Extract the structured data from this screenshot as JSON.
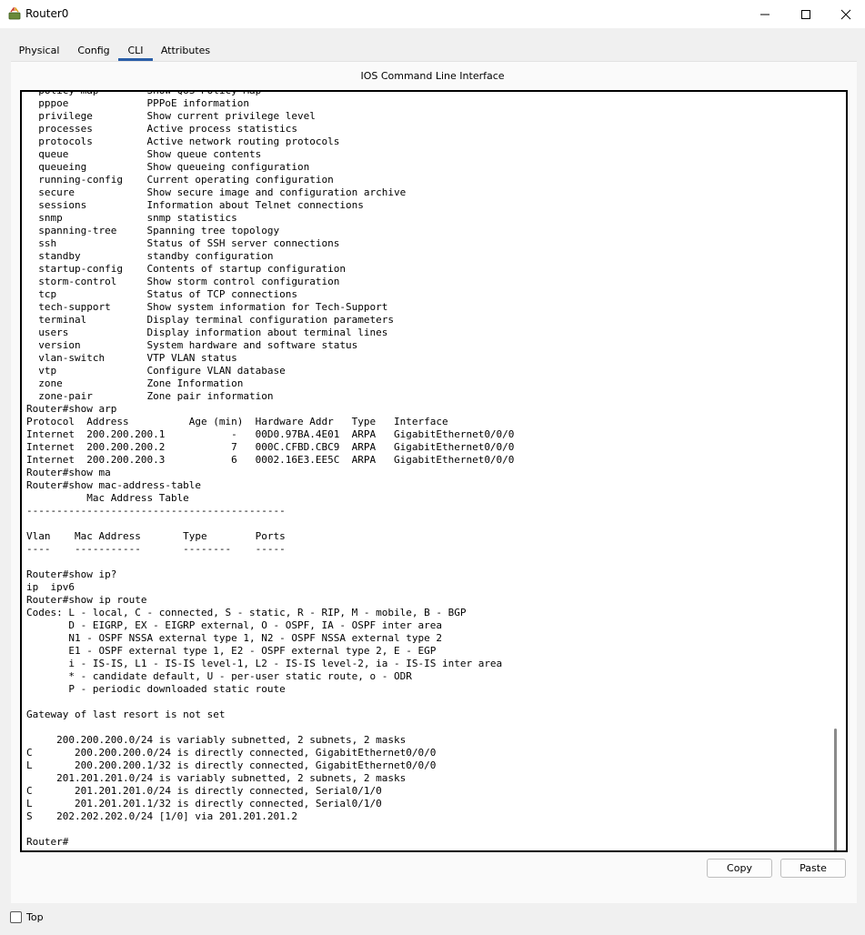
{
  "window": {
    "title": "Router0",
    "icon": "router-icon",
    "controls": {
      "minimize": "minimize-icon",
      "maximize": "maximize-icon",
      "close": "close-icon"
    }
  },
  "tabs": [
    {
      "label": "Physical"
    },
    {
      "label": "Config"
    },
    {
      "label": "CLI",
      "active": true
    },
    {
      "label": "Attributes"
    }
  ],
  "cli": {
    "heading": "IOS Command Line Interface",
    "lines": [
      "  policy-map        Show QoS Policy Map",
      "  pppoe             PPPoE information",
      "  privilege         Show current privilege level",
      "  processes         Active process statistics",
      "  protocols         Active network routing protocols",
      "  queue             Show queue contents",
      "  queueing          Show queueing configuration",
      "  running-config    Current operating configuration",
      "  secure            Show secure image and configuration archive",
      "  sessions          Information about Telnet connections",
      "  snmp              snmp statistics",
      "  spanning-tree     Spanning tree topology",
      "  ssh               Status of SSH server connections",
      "  standby           standby configuration",
      "  startup-config    Contents of startup configuration",
      "  storm-control     Show storm control configuration",
      "  tcp               Status of TCP connections",
      "  tech-support      Show system information for Tech-Support",
      "  terminal          Display terminal configuration parameters",
      "  users             Display information about terminal lines",
      "  version           System hardware and software status",
      "  vlan-switch       VTP VLAN status",
      "  vtp               Configure VLAN database",
      "  zone              Zone Information",
      "  zone-pair         Zone pair information",
      "Router#show arp",
      "Protocol  Address          Age (min)  Hardware Addr   Type   Interface",
      "Internet  200.200.200.1           -   00D0.97BA.4E01  ARPA   GigabitEthernet0/0/0",
      "Internet  200.200.200.2           7   000C.CFBD.CBC9  ARPA   GigabitEthernet0/0/0",
      "Internet  200.200.200.3           6   0002.16E3.EE5C  ARPA   GigabitEthernet0/0/0",
      "Router#show ma",
      "Router#show mac-address-table",
      "          Mac Address Table",
      "-------------------------------------------",
      "",
      "Vlan    Mac Address       Type        Ports",
      "----    -----------       --------    -----",
      "",
      "Router#show ip?",
      "ip  ipv6",
      "Router#show ip route",
      "Codes: L - local, C - connected, S - static, R - RIP, M - mobile, B - BGP",
      "       D - EIGRP, EX - EIGRP external, O - OSPF, IA - OSPF inter area",
      "       N1 - OSPF NSSA external type 1, N2 - OSPF NSSA external type 2",
      "       E1 - OSPF external type 1, E2 - OSPF external type 2, E - EGP",
      "       i - IS-IS, L1 - IS-IS level-1, L2 - IS-IS level-2, ia - IS-IS inter area",
      "       * - candidate default, U - per-user static route, o - ODR",
      "       P - periodic downloaded static route",
      "",
      "Gateway of last resort is not set",
      "",
      "     200.200.200.0/24 is variably subnetted, 2 subnets, 2 masks",
      "C       200.200.200.0/24 is directly connected, GigabitEthernet0/0/0",
      "L       200.200.200.1/32 is directly connected, GigabitEthernet0/0/0",
      "     201.201.201.0/24 is variably subnetted, 2 subnets, 2 masks",
      "C       201.201.201.0/24 is directly connected, Serial0/1/0",
      "L       201.201.201.1/32 is directly connected, Serial0/1/0",
      "S    202.202.202.0/24 [1/0] via 201.201.201.2",
      "",
      "Router#"
    ]
  },
  "buttons": {
    "copy": "Copy",
    "paste": "Paste"
  },
  "footer": {
    "top_label": "Top",
    "top_checked": false
  }
}
